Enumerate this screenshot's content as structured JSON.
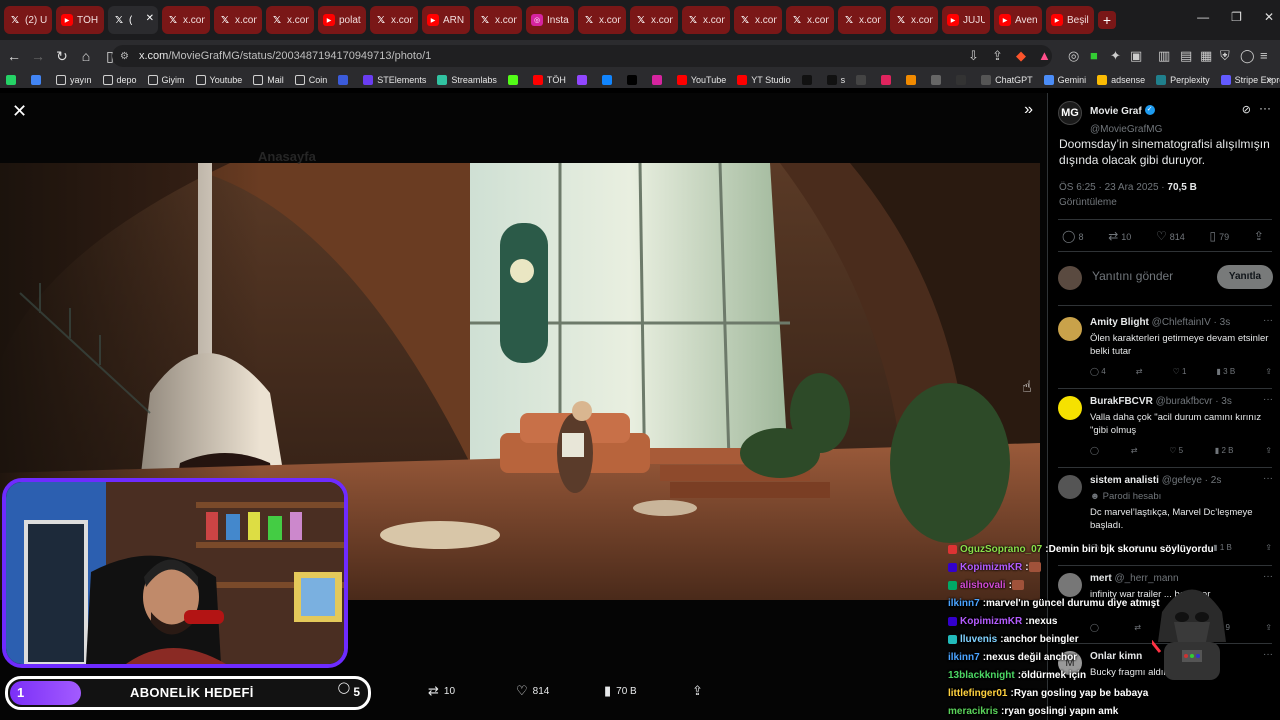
{
  "browser": {
    "tabs": [
      {
        "icon": "x",
        "label": "(2) U"
      },
      {
        "icon": "yt",
        "label": "TÖH"
      },
      {
        "icon": "x",
        "label": "(",
        "active": true
      },
      {
        "icon": "x",
        "label": "x.com"
      },
      {
        "icon": "x",
        "label": "x.com"
      },
      {
        "icon": "x",
        "label": "x.com"
      },
      {
        "icon": "yt",
        "label": "polat"
      },
      {
        "icon": "x",
        "label": "x.com"
      },
      {
        "icon": "yt",
        "label": "ARNI"
      },
      {
        "icon": "x",
        "label": "x.com"
      },
      {
        "icon": "ig",
        "label": "Insta"
      },
      {
        "icon": "x",
        "label": "x.com"
      },
      {
        "icon": "x",
        "label": "x.com"
      },
      {
        "icon": "x",
        "label": "x.com"
      },
      {
        "icon": "x",
        "label": "x.com"
      },
      {
        "icon": "x",
        "label": "x.com"
      },
      {
        "icon": "x",
        "label": "x.com"
      },
      {
        "icon": "x",
        "label": "x.com"
      },
      {
        "icon": "yt",
        "label": "JUJU"
      },
      {
        "icon": "yt",
        "label": "Aven"
      },
      {
        "icon": "yt",
        "label": "Beşil"
      }
    ],
    "url_host": "x.com",
    "url_path": "/MovieGrafMG/status/2003487194170949713/photo/1",
    "bookmarks": [
      {
        "icon": "whatsapp-icon",
        "label": "",
        "color": "#25d366"
      },
      {
        "icon": "chrome-icon",
        "label": "",
        "color": "#4285f4"
      },
      {
        "icon": "folder-icon",
        "label": "yayın",
        "color": "folder"
      },
      {
        "icon": "folder-icon",
        "label": "depo",
        "color": "folder"
      },
      {
        "icon": "folder-icon",
        "label": "Giyim",
        "color": "folder"
      },
      {
        "icon": "folder-icon",
        "label": "Youtube",
        "color": "folder"
      },
      {
        "icon": "folder-icon",
        "label": "Mail",
        "color": "folder"
      },
      {
        "icon": "folder-icon",
        "label": "Coin",
        "color": "folder"
      },
      {
        "icon": "r-icon",
        "label": "",
        "color": "#3b5bdb"
      },
      {
        "icon": "streamelements-icon",
        "label": "STElements",
        "color": "#6a3df2"
      },
      {
        "icon": "streamlabs-icon",
        "label": "Streamlabs",
        "color": "#31c3a2"
      },
      {
        "icon": "kick-icon",
        "label": "",
        "color": "#53fc18"
      },
      {
        "icon": "yt-icon",
        "label": "TÖH",
        "color": "#ff0000"
      },
      {
        "icon": "twitch-icon",
        "label": "",
        "color": "#9146ff"
      },
      {
        "icon": "bluesky-icon",
        "label": "",
        "color": "#1185fe"
      },
      {
        "icon": "x-icon",
        "label": "",
        "color": "#000"
      },
      {
        "icon": "instagram-icon",
        "label": "",
        "color": "#d6249f"
      },
      {
        "icon": "yt-icon",
        "label": "YouTube",
        "color": "#ff0000"
      },
      {
        "icon": "ytstudio-icon",
        "label": "YT Studio",
        "color": "#ff0000"
      },
      {
        "icon": "tiktok-icon",
        "label": "",
        "color": "#111"
      },
      {
        "icon": "tiktok-icon",
        "label": "s",
        "color": "#111"
      },
      {
        "icon": "circle-icon",
        "label": "",
        "color": "#444"
      },
      {
        "icon": "app-icon",
        "label": "",
        "color": "#e0245e"
      },
      {
        "icon": "app-icon",
        "label": "",
        "color": "#f18a00"
      },
      {
        "icon": "app-icon",
        "label": "",
        "color": "#666"
      },
      {
        "icon": "app-icon",
        "label": "",
        "color": "#333"
      },
      {
        "icon": "chatgpt-icon",
        "label": "ChatGPT",
        "color": "#555"
      },
      {
        "icon": "gemini-icon",
        "label": "Gemini",
        "color": "#4b8df8"
      },
      {
        "icon": "adsense-icon",
        "label": "adsense",
        "color": "#fbbc04"
      },
      {
        "icon": "perplexity-icon",
        "label": "Perplexity",
        "color": "#20808d"
      },
      {
        "icon": "stripe-icon",
        "label": "Stripe Express",
        "color": "#635bff"
      }
    ]
  },
  "media": {
    "actions": {
      "retweets": "10",
      "likes": "814",
      "views": "70 B"
    }
  },
  "tweet": {
    "author_name": "Movie Graf",
    "author_handle": "@MovieGrafMG",
    "author_avatar_text": "MG",
    "text": "Doomsday’in sinematografisi alışılmışın dışında olacak gibi duruyor.",
    "time": "ÖS 6:25 · 23 Ara 2025 · ",
    "views": "70,5 B",
    "views_label": "Görüntüleme",
    "stats": {
      "replies": "8",
      "retweets": "10",
      "likes": "814",
      "bookmarks": "79"
    },
    "reply_placeholder": "Yanıtını gönder",
    "reply_button": "Yanıtla"
  },
  "replies": [
    {
      "name": "Amity Blight",
      "handle": "@ChleftainIV · 3s",
      "text": "Ölen karakterleri getirmeye devam etsinler belki tutar",
      "replies": "4",
      "likes": "1",
      "views": "3 B",
      "avatar_color": "#c9a24a"
    },
    {
      "name": "BurakFBCVR",
      "handle": "@burakfbcvr · 3s",
      "text": "Valla daha çok \"acil durum camını kırınız \"gibi olmuş",
      "replies": "",
      "likes": "5",
      "views": "2 B",
      "avatar_color": "#f5e100"
    },
    {
      "name": "sistem analisti",
      "handle": "@gefeye · 2s",
      "badge": "Parodi hesabı",
      "text": "Dc marvel’laştıkça, Marvel Dc’leşmeye başladı.",
      "replies": "",
      "likes": "",
      "views": "1 B",
      "avatar_color": "#555"
    },
    {
      "name": "mert",
      "handle": "@_herr_mann",
      "text": "infinity war trailer ... benziyor",
      "views": "9",
      "avatar_color": "#777"
    },
    {
      "name": "Onlar kimn",
      "handle": "",
      "text": "Bucky fragmı aldınız görün",
      "avatar_color": "#999",
      "avatar_text": "M"
    }
  ],
  "stream": {
    "goal_count": "1",
    "goal_label": "ABONELİK HEDEFİ",
    "goal_target": "5",
    "goal_progress": 0.2,
    "chat": [
      {
        "user": "OguzSoprano_07",
        "color": "#8be04a",
        "msg": "Demin biri bjk skorunu söylüyordu",
        "badge": "#d33"
      },
      {
        "user": "KopimizmKR",
        "color": "#b45cff",
        "msg": "",
        "badge": "#30c",
        "emote": true
      },
      {
        "user": "alishovali",
        "color": "#d24bd2",
        "msg": "",
        "badge": "#0a6",
        "emote": true
      },
      {
        "user": "ilkinn7",
        "color": "#4aa3ff",
        "msg": "marvel'ın güncel durumu diye atmışt"
      },
      {
        "user": "KopimizmKR",
        "color": "#b45cff",
        "msg": "nexus",
        "badge": "#30c"
      },
      {
        "user": "lluvenis",
        "color": "#7fd1ff",
        "msg": "anchor beingler",
        "badge": "#2bb"
      },
      {
        "user": "ilkinn7",
        "color": "#4aa3ff",
        "msg": "nexus değil anchor"
      },
      {
        "user": "13blackknight",
        "color": "#4cd964",
        "msg": "öldürmek için"
      },
      {
        "user": "littlefinger01",
        "color": "#ffd23f",
        "msg": "Ryan gosling yap be babaya"
      },
      {
        "user": "meracikris",
        "color": "#5ad35a",
        "msg": "ryan goslingi yapın amk"
      }
    ]
  }
}
